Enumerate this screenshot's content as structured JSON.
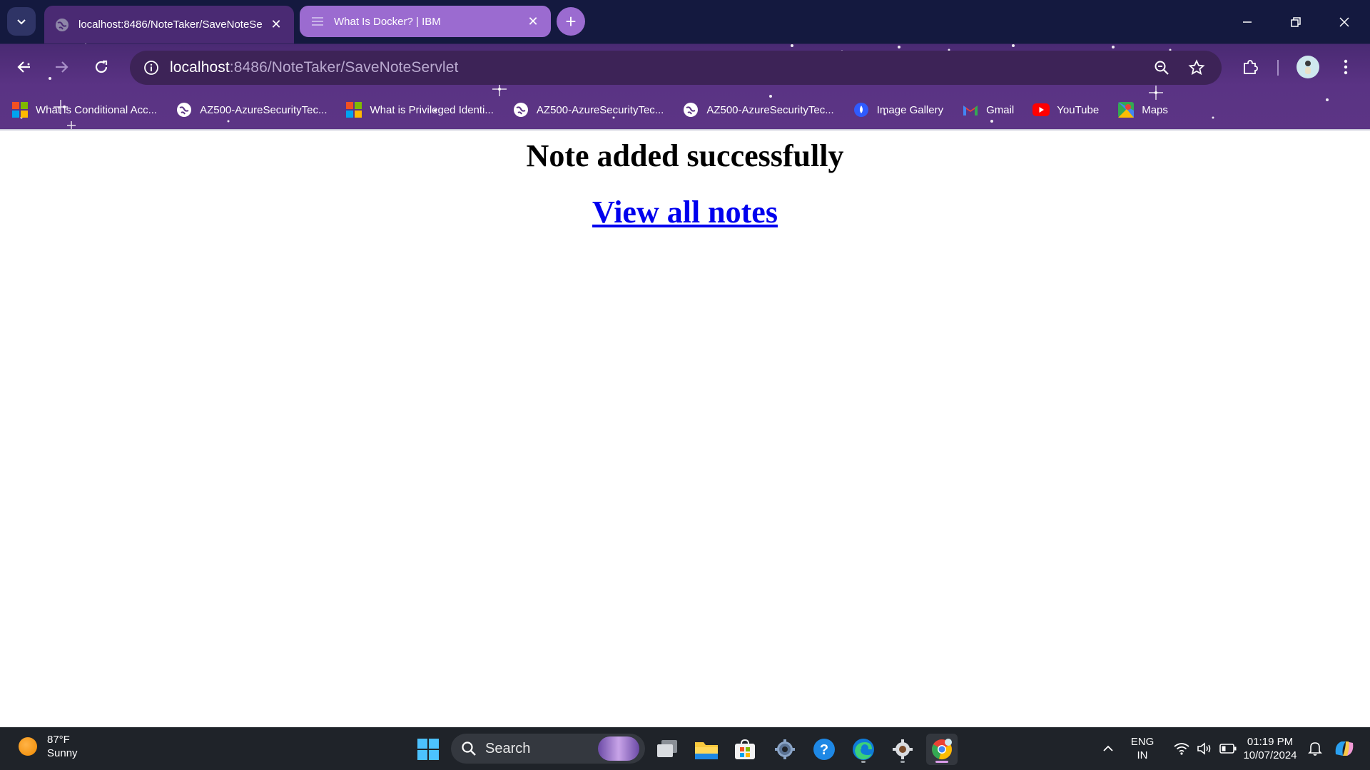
{
  "browser": {
    "tabs": [
      {
        "title": "localhost:8486/NoteTaker/SaveNoteSe",
        "active": true
      },
      {
        "title": "What Is Docker? | IBM",
        "active": false
      }
    ],
    "address": {
      "host": "localhost",
      "rest": ":8486/NoteTaker/SaveNoteServlet"
    },
    "bookmarks": [
      {
        "label": "What is Conditional Acc...",
        "icon": "microsoft-logo-icon"
      },
      {
        "label": "AZ500-AzureSecurityTec...",
        "icon": "globe-icon"
      },
      {
        "label": "What is Privileged Identi...",
        "icon": "microsoft-logo-icon"
      },
      {
        "label": "AZ500-AzureSecurityTec...",
        "icon": "globe-icon"
      },
      {
        "label": "AZ500-AzureSecurityTec...",
        "icon": "globe-icon"
      },
      {
        "label": "Image Gallery",
        "icon": "image-gallery-icon"
      },
      {
        "label": "Gmail",
        "icon": "gmail-icon"
      },
      {
        "label": "YouTube",
        "icon": "youtube-icon"
      },
      {
        "label": "Maps",
        "icon": "maps-icon"
      }
    ]
  },
  "page": {
    "heading": "Note added successfully",
    "link_text": "View all notes"
  },
  "taskbar": {
    "weather": {
      "temp": "87°F",
      "condition": "Sunny"
    },
    "search_label": "Search",
    "language": {
      "line1": "ENG",
      "line2": "IN"
    },
    "clock": {
      "time": "01:19 PM",
      "date": "10/07/2024"
    }
  },
  "colors": {
    "chrome_purple": "#5a3384",
    "tabstrip_navy": "#14193f",
    "inactive_tab": "#9b6bd0",
    "link_blue": "#0000ee",
    "taskbar": "#1f2329"
  }
}
